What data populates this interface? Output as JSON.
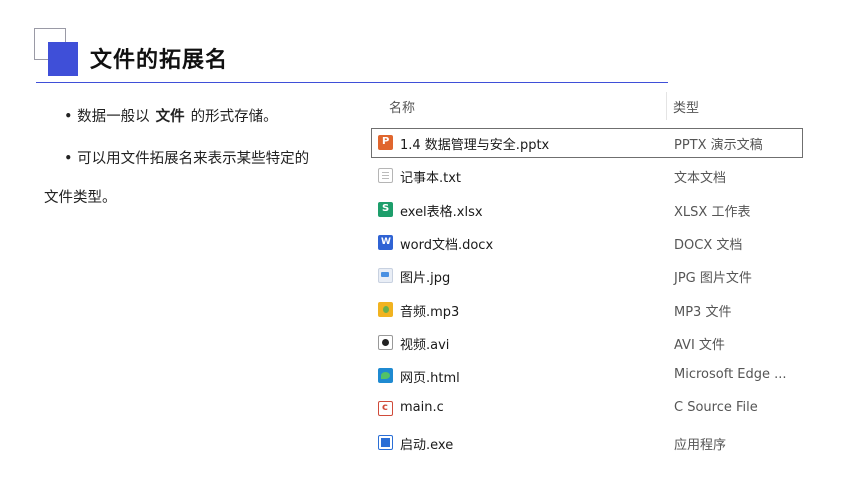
{
  "slide": {
    "title": "文件的拓展名",
    "bullet1_before": "• 数据一般以",
    "bullet1_bold": "文件",
    "bullet1_after": "的形式存储。",
    "bullet2": "• 可以用文件拓展名来表示某些特定的",
    "bullet3": "文件类型。"
  },
  "explorer": {
    "header_name": "名称",
    "header_type": "类型",
    "sort_arrow": "^",
    "files": [
      {
        "name": "1.4 数据管理与安全.pptx",
        "type": "PPTX 演示文稿",
        "icon": "powerpoint-icon",
        "selected": true
      },
      {
        "name": "记事本.txt",
        "type": "文本文档",
        "icon": "text-file-icon"
      },
      {
        "name": "exel表格.xlsx",
        "type": "XLSX 工作表",
        "icon": "spreadsheet-icon"
      },
      {
        "name": "word文档.docx",
        "type": "DOCX 文档",
        "icon": "word-icon"
      },
      {
        "name": "图片.jpg",
        "type": "JPG 图片文件",
        "icon": "image-file-icon"
      },
      {
        "name": "音频.mp3",
        "type": "MP3 文件",
        "icon": "audio-file-icon"
      },
      {
        "name": "视频.avi",
        "type": "AVI 文件",
        "icon": "video-file-icon"
      },
      {
        "name": "网页.html",
        "type": "Microsoft Edge ...",
        "icon": "edge-icon"
      },
      {
        "name": "main.c",
        "type": "C Source File",
        "icon": "c-source-icon"
      },
      {
        "name": "启动.exe",
        "type": "应用程序",
        "icon": "application-icon"
      }
    ]
  }
}
